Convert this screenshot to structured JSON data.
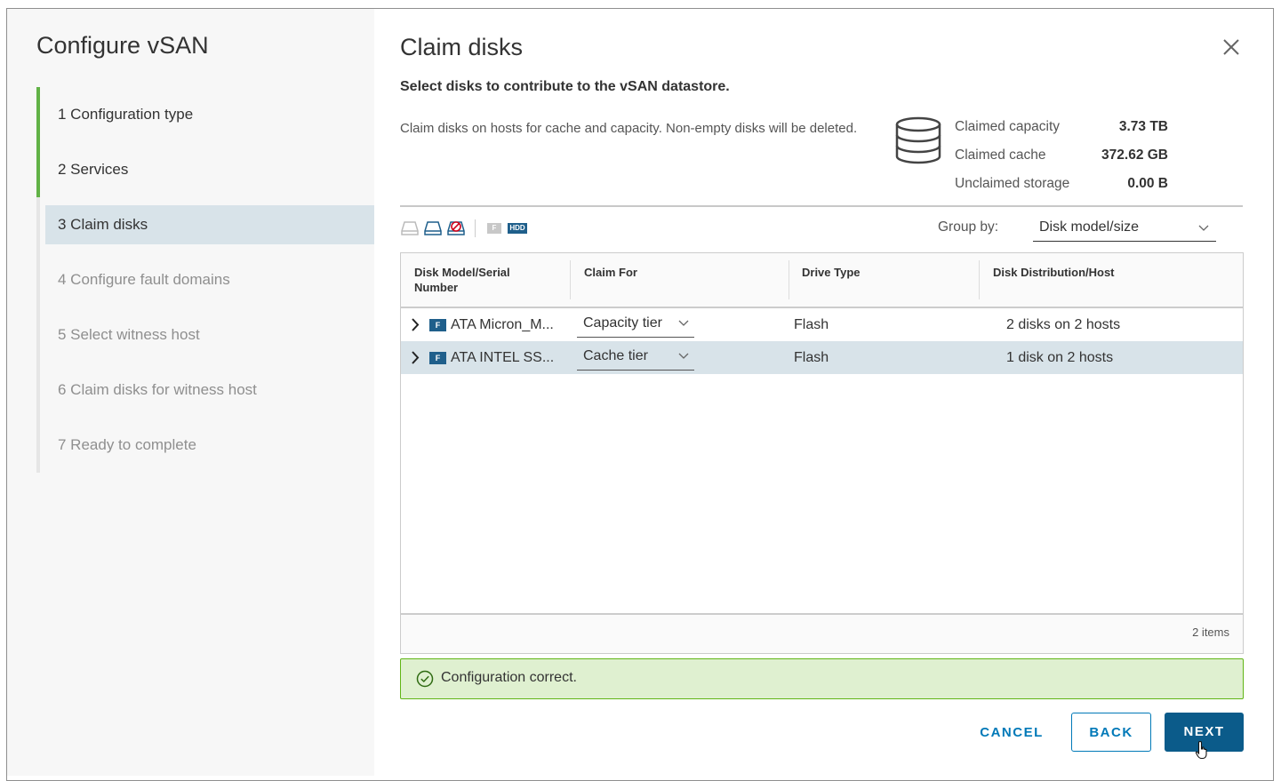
{
  "sidebar": {
    "title": "Configure vSAN",
    "steps": [
      {
        "label": "1 Configuration type",
        "state": "done"
      },
      {
        "label": "2 Services",
        "state": "done"
      },
      {
        "label": "3 Claim disks",
        "state": "active"
      },
      {
        "label": "4 Configure fault domains",
        "state": "todo"
      },
      {
        "label": "5 Select witness host",
        "state": "todo"
      },
      {
        "label": "6 Claim disks for witness host",
        "state": "todo"
      },
      {
        "label": "7 Ready to complete",
        "state": "todo"
      }
    ]
  },
  "main": {
    "title": "Claim disks",
    "subtitle": "Select disks to contribute to the vSAN datastore.",
    "description": "Claim disks on hosts for cache and capacity. Non-empty disks will be deleted.",
    "stats": [
      {
        "label": "Claimed capacity",
        "value": "3.73 TB"
      },
      {
        "label": "Claimed cache",
        "value": "372.62 GB"
      },
      {
        "label": "Unclaimed storage",
        "value": "0.00 B"
      }
    ],
    "toolbar": {
      "icons": [
        "claim-unassigned-icon",
        "claim-capacity-icon",
        "claim-cache-icon",
        "mark-flash-icon",
        "mark-hdd-icon"
      ],
      "flash_tag": "F",
      "hdd_tag": "HDD"
    },
    "group_by": {
      "label": "Group by:",
      "value": "Disk model/size"
    },
    "grid": {
      "columns": [
        "Disk Model/Serial Number",
        "Claim For",
        "Drive Type",
        "Disk Distribution/Host"
      ],
      "rows": [
        {
          "badge": "F",
          "model": "ATA Micron_M...",
          "claim_for": "Capacity tier",
          "drive_type": "Flash",
          "distribution": "2 disks on 2 hosts",
          "selected": false
        },
        {
          "badge": "F",
          "model": "ATA INTEL SS...",
          "claim_for": "Cache tier",
          "drive_type": "Flash",
          "distribution": "1 disk on 2 hosts",
          "selected": true
        }
      ],
      "footer": "2 items"
    },
    "alert": {
      "text": "Configuration correct.",
      "color": "#60b515"
    },
    "buttons": {
      "cancel": "CANCEL",
      "back": "BACK",
      "next": "NEXT"
    }
  },
  "colors": {
    "accent": "#0079b8",
    "primary": "#0b5b8a",
    "success": "#61b246",
    "selected_row": "#d8e3e9"
  }
}
